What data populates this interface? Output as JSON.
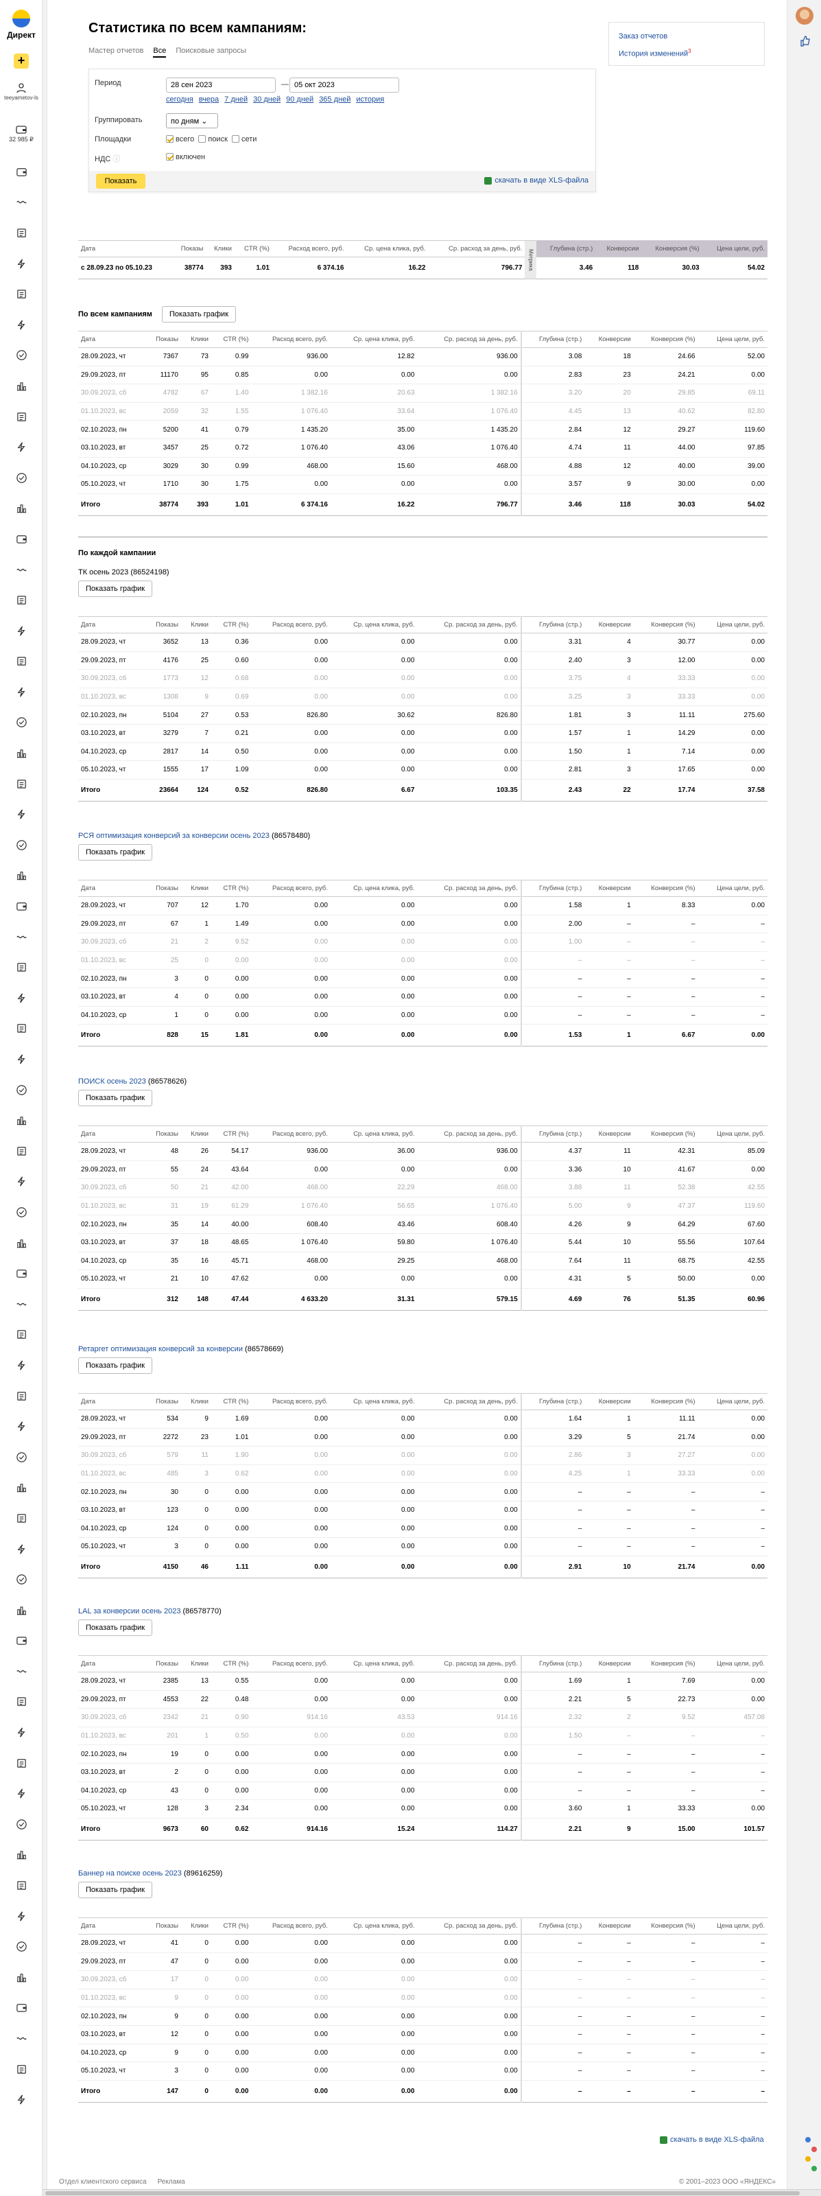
{
  "app": {
    "logo_text": "Директ",
    "user": "teeyametov-ls",
    "balance": "32 985 ₽"
  },
  "page": {
    "title": "Статистика по всем кампаниям:"
  },
  "tabs": [
    "Мастер отчетов",
    "Все",
    "Поисковые запросы"
  ],
  "right_links": {
    "orders": "Заказ отчетов",
    "history": "История изменений",
    "history_badge": "3"
  },
  "filter": {
    "period_label": "Период",
    "date_from": "28 сен 2023",
    "date_to": "05 окт 2023",
    "dash": "—",
    "quick": [
      "сегодня",
      "вчера",
      "7 дней",
      "30 дней",
      "90 дней",
      "365 дней",
      "история"
    ],
    "group_label": "Группировать",
    "group_value": "по дням",
    "places_label": "Площадки",
    "places": [
      "всего",
      "поиск",
      "сети"
    ],
    "vat_label": "НДС",
    "vat_value": "включен",
    "show_button": "Показать",
    "xls_label": "скачать в виде XLS-файла"
  },
  "columns": [
    "Дата",
    "Показы",
    "Клики",
    "CTR (%)",
    "Расход всего, руб.",
    "Ср. цена клика, руб.",
    "Ср. расход за день, руб.",
    "Глубина (стр.)",
    "Конверсии",
    "Конверсия (%)",
    "Цена цели, руб."
  ],
  "summary": {
    "metric_label": "Метрика",
    "row": [
      "с 28.09.23 по 05.10.23",
      "38774",
      "393",
      "1.01",
      "6 374.16",
      "16.22",
      "796.77",
      "3.46",
      "118",
      "30.03",
      "54.02"
    ]
  },
  "all_campaigns": {
    "title": "По всем кампаниям",
    "chart_button": "Показать график",
    "rows": [
      [
        "28.09.2023, чт",
        "7367",
        "73",
        "0.99",
        "936.00",
        "12.82",
        "936.00",
        "3.08",
        "18",
        "24.66",
        "52.00"
      ],
      [
        "29.09.2023, пт",
        "11170",
        "95",
        "0.85",
        "0.00",
        "0.00",
        "0.00",
        "2.83",
        "23",
        "24.21",
        "0.00"
      ],
      [
        "30.09.2023, сб",
        "4782",
        "67",
        "1.40",
        "1 382.16",
        "20.63",
        "1 382.16",
        "3.20",
        "20",
        "29.85",
        "69.11"
      ],
      [
        "01.10.2023, вс",
        "2059",
        "32",
        "1.55",
        "1 076.40",
        "33.64",
        "1 076.40",
        "4.45",
        "13",
        "40.62",
        "82.80"
      ],
      [
        "02.10.2023, пн",
        "5200",
        "41",
        "0.79",
        "1 435.20",
        "35.00",
        "1 435.20",
        "2.84",
        "12",
        "29.27",
        "119.60"
      ],
      [
        "03.10.2023, вт",
        "3457",
        "25",
        "0.72",
        "1 076.40",
        "43.06",
        "1 076.40",
        "4.74",
        "11",
        "44.00",
        "97.85"
      ],
      [
        "04.10.2023, ср",
        "3029",
        "30",
        "0.99",
        "468.00",
        "15.60",
        "468.00",
        "4.88",
        "12",
        "40.00",
        "39.00"
      ],
      [
        "05.10.2023, чт",
        "1710",
        "30",
        "1.75",
        "0.00",
        "0.00",
        "0.00",
        "3.57",
        "9",
        "30.00",
        "0.00"
      ]
    ],
    "total": [
      "Итого",
      "38774",
      "393",
      "1.01",
      "6 374.16",
      "16.22",
      "796.77",
      "3.46",
      "118",
      "30.03",
      "54.02"
    ]
  },
  "each_campaign_title": "По каждой кампании",
  "campaigns": [
    {
      "name": "ТК осень 2023",
      "id": "(86524198)",
      "link": false,
      "rows": [
        [
          "28.09.2023, чт",
          "3652",
          "13",
          "0.36",
          "0.00",
          "0.00",
          "0.00",
          "3.31",
          "4",
          "30.77",
          "0.00"
        ],
        [
          "29.09.2023, пт",
          "4176",
          "25",
          "0.60",
          "0.00",
          "0.00",
          "0.00",
          "2.40",
          "3",
          "12.00",
          "0.00"
        ],
        [
          "30.09.2023, сб",
          "1773",
          "12",
          "0.68",
          "0.00",
          "0.00",
          "0.00",
          "3.75",
          "4",
          "33.33",
          "0.00"
        ],
        [
          "01.10.2023, вс",
          "1308",
          "9",
          "0.69",
          "0.00",
          "0.00",
          "0.00",
          "3.25",
          "3",
          "33.33",
          "0.00"
        ],
        [
          "02.10.2023, пн",
          "5104",
          "27",
          "0.53",
          "826.80",
          "30.62",
          "826.80",
          "1.81",
          "3",
          "11.11",
          "275.60"
        ],
        [
          "03.10.2023, вт",
          "3279",
          "7",
          "0.21",
          "0.00",
          "0.00",
          "0.00",
          "1.57",
          "1",
          "14.29",
          "0.00"
        ],
        [
          "04.10.2023, ср",
          "2817",
          "14",
          "0.50",
          "0.00",
          "0.00",
          "0.00",
          "1.50",
          "1",
          "7.14",
          "0.00"
        ],
        [
          "05.10.2023, чт",
          "1555",
          "17",
          "1.09",
          "0.00",
          "0.00",
          "0.00",
          "2.81",
          "3",
          "17.65",
          "0.00"
        ]
      ],
      "total": [
        "Итого",
        "23664",
        "124",
        "0.52",
        "826.80",
        "6.67",
        "103.35",
        "2.43",
        "22",
        "17.74",
        "37.58"
      ]
    },
    {
      "name": "РСЯ оптимизация конверсий за конверсии осень 2023",
      "id": "(86578480)",
      "link": true,
      "rows": [
        [
          "28.09.2023, чт",
          "707",
          "12",
          "1.70",
          "0.00",
          "0.00",
          "0.00",
          "1.58",
          "1",
          "8.33",
          "0.00"
        ],
        [
          "29.09.2023, пт",
          "67",
          "1",
          "1.49",
          "0.00",
          "0.00",
          "0.00",
          "2.00",
          "–",
          "–",
          "–"
        ],
        [
          "30.09.2023, сб",
          "21",
          "2",
          "9.52",
          "0.00",
          "0.00",
          "0.00",
          "1.00",
          "–",
          "–",
          "–"
        ],
        [
          "01.10.2023, вс",
          "25",
          "0",
          "0.00",
          "0.00",
          "0.00",
          "0.00",
          "–",
          "–",
          "–",
          "–"
        ],
        [
          "02.10.2023, пн",
          "3",
          "0",
          "0.00",
          "0.00",
          "0.00",
          "0.00",
          "–",
          "–",
          "–",
          "–"
        ],
        [
          "03.10.2023, вт",
          "4",
          "0",
          "0.00",
          "0.00",
          "0.00",
          "0.00",
          "–",
          "–",
          "–",
          "–"
        ],
        [
          "04.10.2023, ср",
          "1",
          "0",
          "0.00",
          "0.00",
          "0.00",
          "0.00",
          "–",
          "–",
          "–",
          "–"
        ]
      ],
      "total": [
        "Итого",
        "828",
        "15",
        "1.81",
        "0.00",
        "0.00",
        "0.00",
        "1.53",
        "1",
        "6.67",
        "0.00"
      ]
    },
    {
      "name": "ПОИСК осень 2023",
      "id": "(86578626)",
      "link": true,
      "rows": [
        [
          "28.09.2023, чт",
          "48",
          "26",
          "54.17",
          "936.00",
          "36.00",
          "936.00",
          "4.37",
          "11",
          "42.31",
          "85.09"
        ],
        [
          "29.09.2023, пт",
          "55",
          "24",
          "43.64",
          "0.00",
          "0.00",
          "0.00",
          "3.36",
          "10",
          "41.67",
          "0.00"
        ],
        [
          "30.09.2023, сб",
          "50",
          "21",
          "42.00",
          "468.00",
          "22.29",
          "468.00",
          "3.88",
          "11",
          "52.38",
          "42.55"
        ],
        [
          "01.10.2023, вс",
          "31",
          "19",
          "61.29",
          "1 076.40",
          "56.65",
          "1 076.40",
          "5.00",
          "9",
          "47.37",
          "119.60"
        ],
        [
          "02.10.2023, пн",
          "35",
          "14",
          "40.00",
          "608.40",
          "43.46",
          "608.40",
          "4.26",
          "9",
          "64.29",
          "67.60"
        ],
        [
          "03.10.2023, вт",
          "37",
          "18",
          "48.65",
          "1 076.40",
          "59.80",
          "1 076.40",
          "5.44",
          "10",
          "55.56",
          "107.64"
        ],
        [
          "04.10.2023, ср",
          "35",
          "16",
          "45.71",
          "468.00",
          "29.25",
          "468.00",
          "7.64",
          "11",
          "68.75",
          "42.55"
        ],
        [
          "05.10.2023, чт",
          "21",
          "10",
          "47.62",
          "0.00",
          "0.00",
          "0.00",
          "4.31",
          "5",
          "50.00",
          "0.00"
        ]
      ],
      "total": [
        "Итого",
        "312",
        "148",
        "47.44",
        "4 633.20",
        "31.31",
        "579.15",
        "4.69",
        "76",
        "51.35",
        "60.96"
      ]
    },
    {
      "name": "Ретаргет оптимизация конверсий за конверсии",
      "id": "(86578669)",
      "link": true,
      "rows": [
        [
          "28.09.2023, чт",
          "534",
          "9",
          "1.69",
          "0.00",
          "0.00",
          "0.00",
          "1.64",
          "1",
          "11.11",
          "0.00"
        ],
        [
          "29.09.2023, пт",
          "2272",
          "23",
          "1.01",
          "0.00",
          "0.00",
          "0.00",
          "3.29",
          "5",
          "21.74",
          "0.00"
        ],
        [
          "30.09.2023, сб",
          "579",
          "11",
          "1.90",
          "0.00",
          "0.00",
          "0.00",
          "2.86",
          "3",
          "27.27",
          "0.00"
        ],
        [
          "01.10.2023, вс",
          "485",
          "3",
          "0.62",
          "0.00",
          "0.00",
          "0.00",
          "4.25",
          "1",
          "33.33",
          "0.00"
        ],
        [
          "02.10.2023, пн",
          "30",
          "0",
          "0.00",
          "0.00",
          "0.00",
          "0.00",
          "–",
          "–",
          "–",
          "–"
        ],
        [
          "03.10.2023, вт",
          "123",
          "0",
          "0.00",
          "0.00",
          "0.00",
          "0.00",
          "–",
          "–",
          "–",
          "–"
        ],
        [
          "04.10.2023, ср",
          "124",
          "0",
          "0.00",
          "0.00",
          "0.00",
          "0.00",
          "–",
          "–",
          "–",
          "–"
        ],
        [
          "05.10.2023, чт",
          "3",
          "0",
          "0.00",
          "0.00",
          "0.00",
          "0.00",
          "–",
          "–",
          "–",
          "–"
        ]
      ],
      "total": [
        "Итого",
        "4150",
        "46",
        "1.11",
        "0.00",
        "0.00",
        "0.00",
        "2.91",
        "10",
        "21.74",
        "0.00"
      ]
    },
    {
      "name": "LAL за конверсии осень 2023",
      "id": "(86578770)",
      "link": true,
      "rows": [
        [
          "28.09.2023, чт",
          "2385",
          "13",
          "0.55",
          "0.00",
          "0.00",
          "0.00",
          "1.69",
          "1",
          "7.69",
          "0.00"
        ],
        [
          "29.09.2023, пт",
          "4553",
          "22",
          "0.48",
          "0.00",
          "0.00",
          "0.00",
          "2.21",
          "5",
          "22.73",
          "0.00"
        ],
        [
          "30.09.2023, сб",
          "2342",
          "21",
          "0.90",
          "914.16",
          "43.53",
          "914.16",
          "2.32",
          "2",
          "9.52",
          "457.08"
        ],
        [
          "01.10.2023, вс",
          "201",
          "1",
          "0.50",
          "0.00",
          "0.00",
          "0.00",
          "1.50",
          "–",
          "–",
          "–"
        ],
        [
          "02.10.2023, пн",
          "19",
          "0",
          "0.00",
          "0.00",
          "0.00",
          "0.00",
          "–",
          "–",
          "–",
          "–"
        ],
        [
          "03.10.2023, вт",
          "2",
          "0",
          "0.00",
          "0.00",
          "0.00",
          "0.00",
          "–",
          "–",
          "–",
          "–"
        ],
        [
          "04.10.2023, ср",
          "43",
          "0",
          "0.00",
          "0.00",
          "0.00",
          "0.00",
          "–",
          "–",
          "–",
          "–"
        ],
        [
          "05.10.2023, чт",
          "128",
          "3",
          "2.34",
          "0.00",
          "0.00",
          "0.00",
          "3.60",
          "1",
          "33.33",
          "0.00"
        ]
      ],
      "total": [
        "Итого",
        "9673",
        "60",
        "0.62",
        "914.16",
        "15.24",
        "114.27",
        "2.21",
        "9",
        "15.00",
        "101.57"
      ]
    },
    {
      "name": "Баннер на поиске осень 2023",
      "id": "(89616259)",
      "link": true,
      "rows": [
        [
          "28.09.2023, чт",
          "41",
          "0",
          "0.00",
          "0.00",
          "0.00",
          "0.00",
          "–",
          "–",
          "–",
          "–"
        ],
        [
          "29.09.2023, пт",
          "47",
          "0",
          "0.00",
          "0.00",
          "0.00",
          "0.00",
          "–",
          "–",
          "–",
          "–"
        ],
        [
          "30.09.2023, сб",
          "17",
          "0",
          "0.00",
          "0.00",
          "0.00",
          "0.00",
          "–",
          "–",
          "–",
          "–"
        ],
        [
          "01.10.2023, вс",
          "9",
          "0",
          "0.00",
          "0.00",
          "0.00",
          "0.00",
          "–",
          "–",
          "–",
          "–"
        ],
        [
          "02.10.2023, пн",
          "9",
          "0",
          "0.00",
          "0.00",
          "0.00",
          "0.00",
          "–",
          "–",
          "–",
          "–"
        ],
        [
          "03.10.2023, вт",
          "12",
          "0",
          "0.00",
          "0.00",
          "0.00",
          "0.00",
          "–",
          "–",
          "–",
          "–"
        ],
        [
          "04.10.2023, ср",
          "9",
          "0",
          "0.00",
          "0.00",
          "0.00",
          "0.00",
          "–",
          "–",
          "–",
          "–"
        ],
        [
          "05.10.2023, чт",
          "3",
          "0",
          "0.00",
          "0.00",
          "0.00",
          "0.00",
          "–",
          "–",
          "–",
          "–"
        ]
      ],
      "total": [
        "Итого",
        "147",
        "0",
        "0.00",
        "0.00",
        "0.00",
        "0.00",
        "–",
        "–",
        "–",
        "–"
      ]
    }
  ],
  "footer": {
    "support": "Отдел клиентского сервиса",
    "ads": "Реклама",
    "copyright": "© 2001–2023 ООО «ЯНДЕКС»"
  },
  "sidebar_icons": [
    "wallet-icon",
    "wave-icon",
    "doc-icon",
    "bolt-icon",
    "doc-icon",
    "bolt-icon",
    "check-icon",
    "chart-icon",
    "doc-icon",
    "bolt-icon",
    "check-icon",
    "chart-icon"
  ]
}
